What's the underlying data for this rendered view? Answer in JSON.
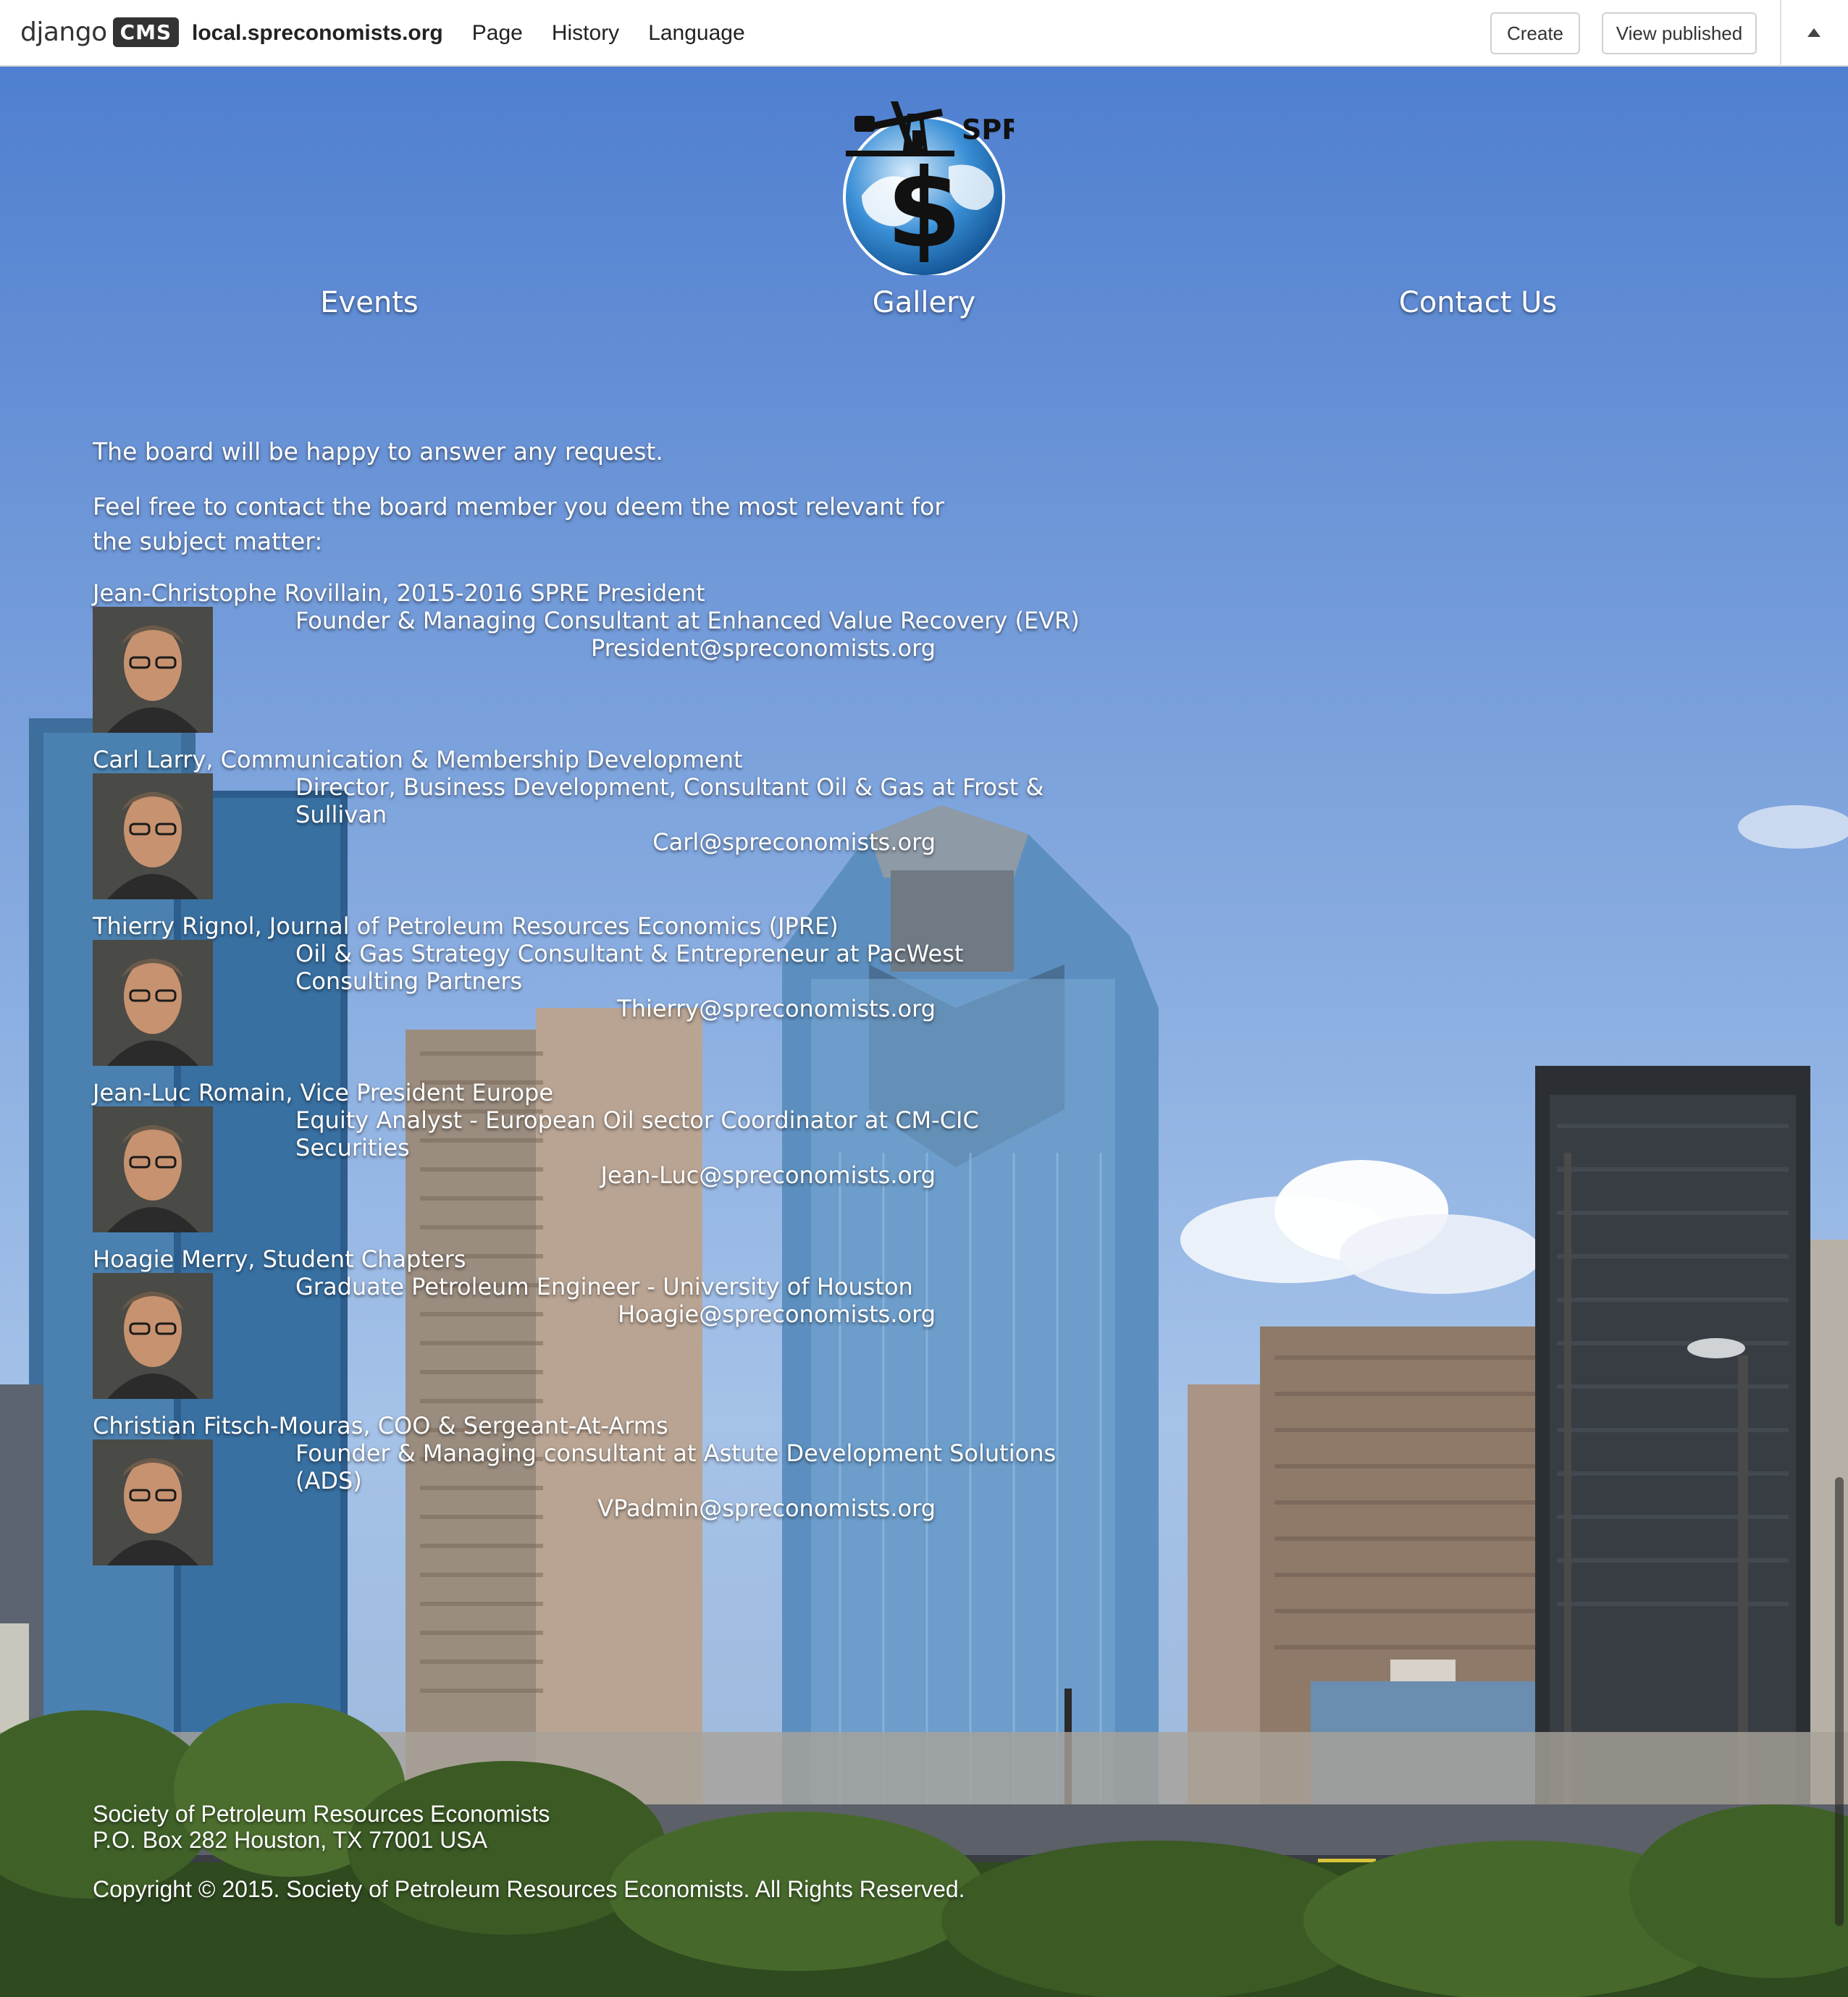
{
  "toolbar": {
    "brand_text": "django",
    "brand_badge": "CMS",
    "site": "local.spreconomists.org",
    "menu": [
      "Page",
      "History",
      "Language"
    ],
    "create_label": "Create",
    "view_published_label": "View published",
    "collapse_icon": "caret-up-icon"
  },
  "logo": {
    "text": "SPRE",
    "icon": "oil-pump-globe-dollar-logo"
  },
  "nav": {
    "items": [
      "Events",
      "Gallery",
      "Contact Us"
    ]
  },
  "content": {
    "intro": "The board will be happy to answer any request.",
    "contact_note": "Feel free to contact the board member you deem the most relevant for the subject matter:",
    "members": [
      {
        "name": "Jean-Christophe Rovillain, 2015-2016 SPRE President",
        "role": "Founder & Managing Consultant at Enhanced Value Recovery (EVR)",
        "email": "President@spreconomists.org"
      },
      {
        "name": "Carl Larry, Communication & Membership Development",
        "role": "Director, Business Development, Consultant Oil & Gas at Frost & Sullivan",
        "email": "Carl@spreconomists.org"
      },
      {
        "name": "Thierry Rignol, Journal of Petroleum Resources Economics (JPRE)",
        "role": "Oil & Gas Strategy Consultant & Entrepreneur at PacWest Consulting Partners",
        "email": "Thierry@spreconomists.org"
      },
      {
        "name": "Jean-Luc Romain, Vice President Europe",
        "role": "Equity Analyst - European Oil sector Coordinator at CM-CIC Securities",
        "email": "Jean-Luc@spreconomists.org"
      },
      {
        "name": "Hoagie Merry, Student Chapters",
        "role": "Graduate Petroleum Engineer - University of Houston",
        "email": "Hoagie@spreconomists.org"
      },
      {
        "name": "Christian Fitsch-Mouras, COO & Sergeant-At-Arms",
        "role": "Founder & Managing consultant at Astute Development Solutions (ADS)",
        "email": "VPadmin@spreconomists.org"
      }
    ]
  },
  "footer": {
    "org": "Society of Petroleum Resources Economists",
    "address": "P.O. Box 282 Houston, TX 77001 USA",
    "copyright": "Copyright © 2015. Society of Petroleum Resources Economists. All Rights Reserved."
  }
}
